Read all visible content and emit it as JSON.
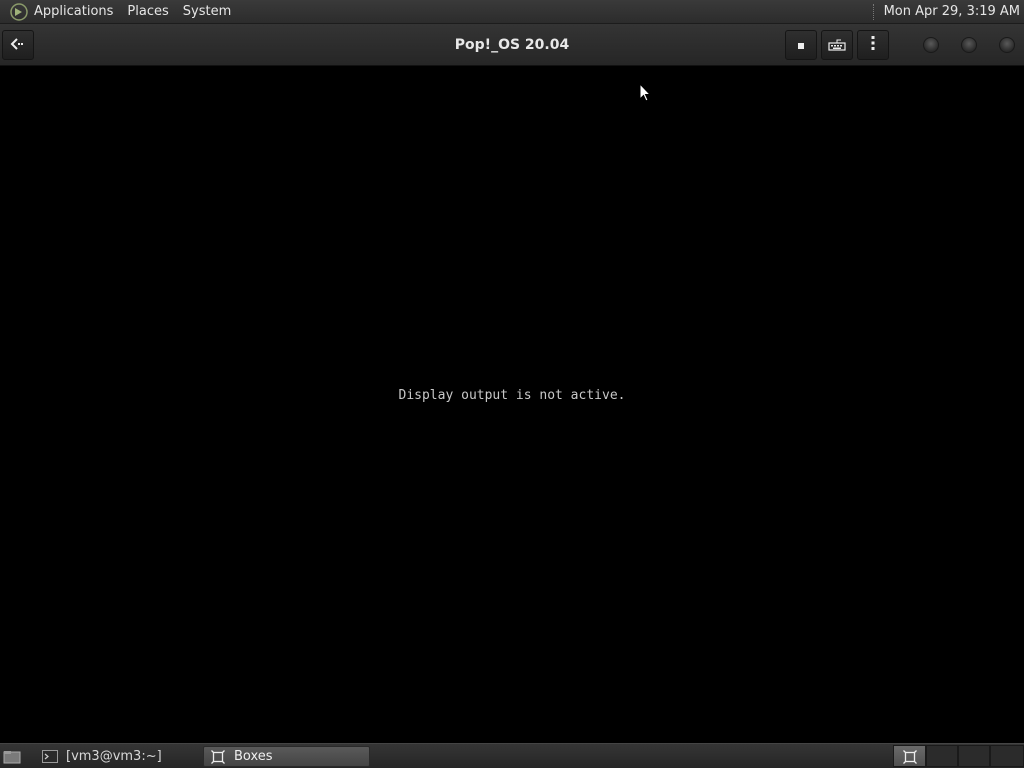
{
  "top_panel": {
    "menus": [
      "Applications",
      "Places",
      "System"
    ],
    "clock": "Mon Apr 29,  3:19 AM"
  },
  "headerbar": {
    "title": "Pop!_OS 20.04",
    "icons": {
      "back": "back-arrow-icon",
      "stop": "stop-icon",
      "keyboard": "keyboard-icon",
      "menu": "vertical-dots-menu-icon"
    }
  },
  "display": {
    "message": "Display output is not active."
  },
  "taskbar": {
    "tasks": [
      {
        "label": "[vm3@vm3:~]",
        "icon": "terminal-icon",
        "active": false
      },
      {
        "label": "Boxes",
        "icon": "boxes-icon",
        "active": true
      }
    ]
  },
  "colors": {
    "panel": "#2c2c2c",
    "display_bg": "#000000",
    "text": "#e6e6e6"
  }
}
